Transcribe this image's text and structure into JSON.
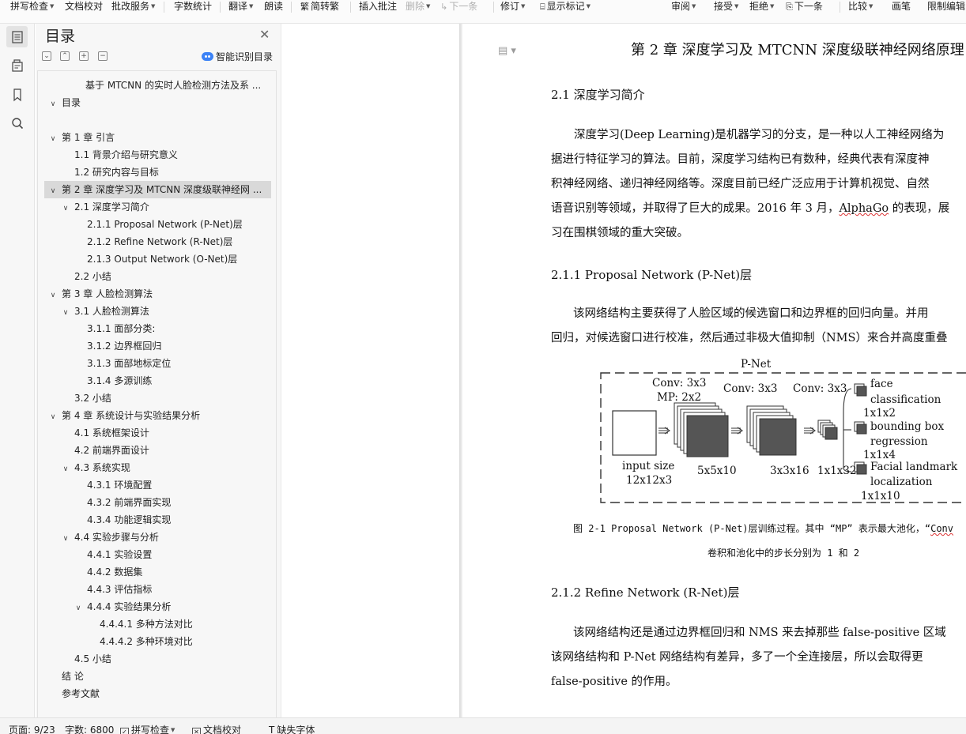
{
  "toolbar": {
    "items": [
      {
        "label": "拼写检查",
        "caret": true
      },
      {
        "label": "文档校对",
        "caret": false
      },
      {
        "label": "批改服务",
        "caret": true
      },
      {
        "label": "字数统计",
        "caret": false
      },
      {
        "label": "翻译",
        "caret": true
      },
      {
        "label": "朗读",
        "caret": false
      },
      {
        "label": "简转繁",
        "caret": false
      },
      {
        "label": "插入批注",
        "caret": false
      },
      {
        "label": "删除",
        "caret": true
      },
      {
        "label": "下一条",
        "caret": false
      },
      {
        "label": "修订",
        "caret": true
      },
      {
        "label": "显示标记",
        "caret": true
      },
      {
        "label": "审阅",
        "caret": true
      },
      {
        "label": "接受",
        "caret": true
      },
      {
        "label": "拒绝",
        "caret": true
      },
      {
        "label": "下一条",
        "caret": false
      },
      {
        "label": "比较",
        "caret": true
      },
      {
        "label": "画笔",
        "caret": false
      },
      {
        "label": "限制编辑",
        "caret": false
      }
    ]
  },
  "rail": {
    "icons": [
      "toc-icon",
      "navigation-icon",
      "bookmark-icon",
      "search-icon"
    ]
  },
  "toc": {
    "title": "目录",
    "smart_label": "智能识别目录",
    "items": [
      {
        "text": "基于 MTCNN 的实时人脸检测方法及系 ...",
        "chev": ""
      },
      {
        "text": "目录",
        "chev": "∨"
      },
      {
        "text": "第 1 章  引言",
        "chev": "∨"
      },
      {
        "text": "1.1 背景介绍与研究意义",
        "chev": ""
      },
      {
        "text": "1.2 研究内容与目标",
        "chev": ""
      },
      {
        "text": "第 2 章  深度学习及 MTCNN 深度级联神经网 ...",
        "chev": "∨"
      },
      {
        "text": "2.1  深度学习简介",
        "chev": "∨"
      },
      {
        "text": "2.1.1 Proposal Network (P-Net)层",
        "chev": ""
      },
      {
        "text": "2.1.2 Refine Network (R-Net)层",
        "chev": ""
      },
      {
        "text": "2.1.3 Output Network (O-Net)层",
        "chev": ""
      },
      {
        "text": "2.2 小结",
        "chev": ""
      },
      {
        "text": "第 3 章  人脸检测算法",
        "chev": "∨"
      },
      {
        "text": "3.1  人脸检测算法",
        "chev": "∨"
      },
      {
        "text": "3.1.1  面部分类:",
        "chev": ""
      },
      {
        "text": "3.1.2  边界框回归",
        "chev": ""
      },
      {
        "text": "3.1.3  面部地标定位",
        "chev": ""
      },
      {
        "text": "3.1.4  多源训练",
        "chev": ""
      },
      {
        "text": "3.2  小结",
        "chev": ""
      },
      {
        "text": "第 4 章  系统设计与实验结果分析",
        "chev": "∨"
      },
      {
        "text": "4.1 系统框架设计",
        "chev": ""
      },
      {
        "text": "4.2 前端界面设计",
        "chev": ""
      },
      {
        "text": "4.3 系统实现",
        "chev": "∨"
      },
      {
        "text": "4.3.1  环境配置",
        "chev": ""
      },
      {
        "text": "4.3.2  前端界面实现",
        "chev": ""
      },
      {
        "text": "4.3.4 功能逻辑实现",
        "chev": ""
      },
      {
        "text": "4.4 实验步骤与分析",
        "chev": "∨"
      },
      {
        "text": "4.4.1  实验设置",
        "chev": ""
      },
      {
        "text": "4.4.2  数据集",
        "chev": ""
      },
      {
        "text": "4.4.3  评估指标",
        "chev": ""
      },
      {
        "text": "4.4.4  实验结果分析",
        "chev": "∨"
      },
      {
        "text": "4.4.4.1 多种方法对比",
        "chev": ""
      },
      {
        "text": "4.4.4.2 多种环境对比",
        "chev": ""
      },
      {
        "text": "4.5 小结",
        "chev": ""
      },
      {
        "text": "结    论",
        "chev": ""
      },
      {
        "text": "参考文献",
        "chev": ""
      }
    ]
  },
  "doc": {
    "chapter_title": "第 2 章  深度学习及 MTCNN 深度级联神经网络原理",
    "sec_2_1": "2.1  深度学习简介",
    "p1": [
      "深度学习(Deep Learning)是机器学习的分支，是一种以人工神经网络为",
      "据进行特征学习的算法。目前，深度学习结构已有数种，经典代表有深度神",
      "积神经网络、递归神经网络等。深度目前已经广泛应用于计算机视觉、自然",
      "语音识别等领域，并取得了巨大的成果。2016 年 3 月，",
      "AlphaGo",
      " 的表现，展",
      "习在围棋领域的重大突破。"
    ],
    "sec_2_1_1": "2.1.1 Proposal Network (P-Net)层",
    "p2": [
      "该网络结构主要获得了人脸区域的候选窗口和边界框的回归向量。并用",
      "回归，对候选窗口进行校准，然后通过非极大值抑制（NMS）来合并高度重叠"
    ],
    "figure": {
      "title": "P-Net",
      "conv1": "Conv: 3x3",
      "mp": "MP: 2x2",
      "conv2": "Conv: 3x3",
      "conv3": "Conv: 3x3",
      "input1": "input size",
      "input2": "12x12x3",
      "s1": "5x5x10",
      "s2": "3x3x16",
      "s3": "1x1x32",
      "o1a": "face",
      "o1b": "classification",
      "o1d": "1x1x2",
      "o2a": "bounding box",
      "o2b": "regression",
      "o2d": "1x1x4",
      "o3a": "Facial landmark",
      "o3b": "localization",
      "o3d": "1x1x10"
    },
    "caption1a": "图 2-1  Proposal Network (P-Net)层训练过程。其中 “MP” 表示最大池化，“",
    "caption1b": "Conv",
    "caption2": "卷积和池化中的步长分别为 1 和 2",
    "sec_2_1_2": "2.1.2 Refine Network (R-Net)层",
    "p3": [
      "该网络结构还是通过边界框回归和 NMS 来去掉那些 false-positive 区域",
      "该网络结构和 P-Net 网络结构有差异，多了一个全连接层，所以会取得更",
      "false-positive 的作用。"
    ]
  },
  "status": {
    "page": "页面: 9/23",
    "words": "字数: 6800",
    "spell": "拼写检查",
    "proof": "文档校对",
    "missing_font": "缺失字体"
  }
}
